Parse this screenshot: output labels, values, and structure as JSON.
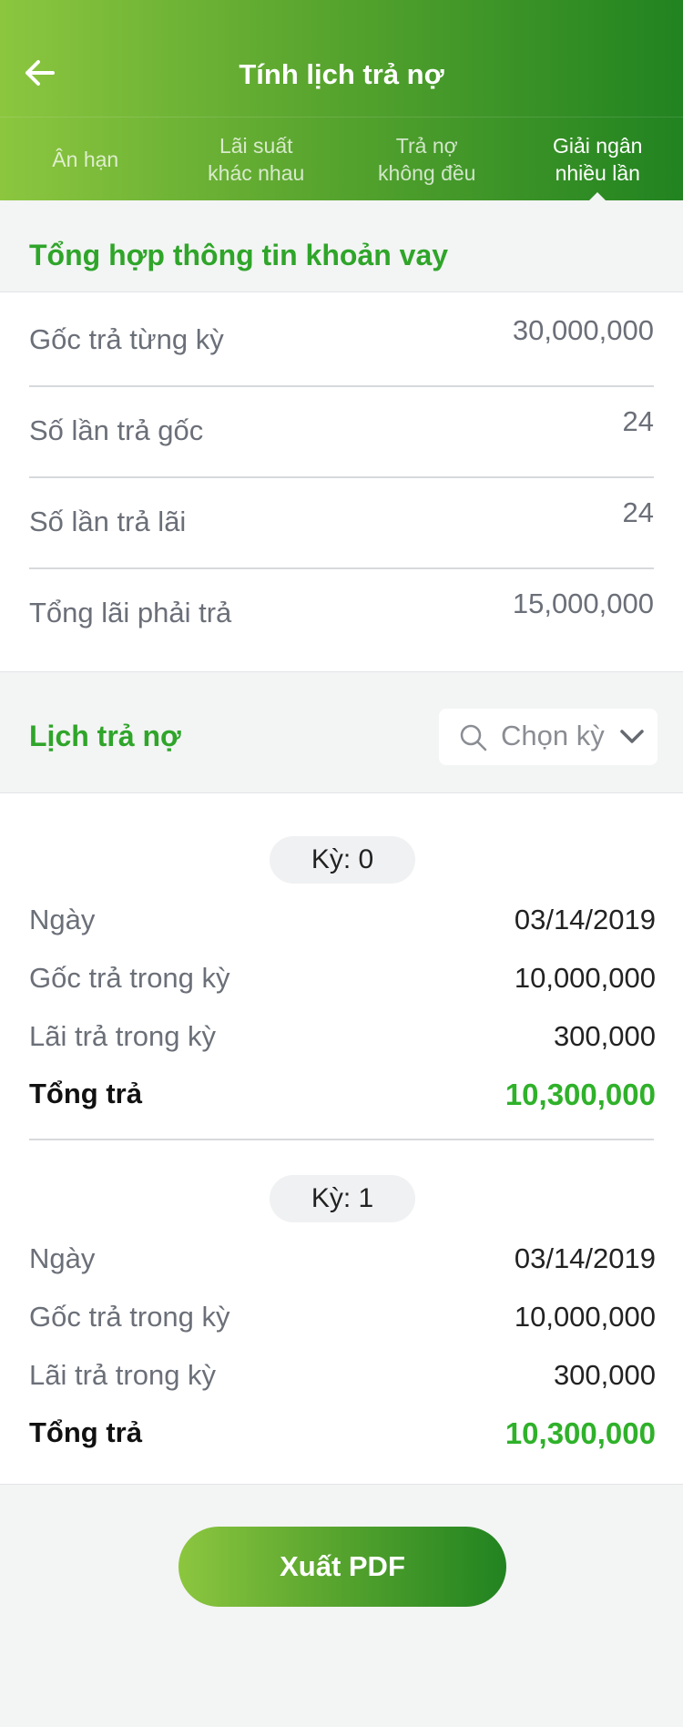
{
  "header": {
    "title": "Tính lịch trả nợ",
    "back_icon": "arrow-left-icon"
  },
  "tabs": [
    {
      "label": "Ân hạn",
      "active": false
    },
    {
      "label": "Lãi suất\nkhác nhau",
      "active": false
    },
    {
      "label": "Trả nợ\nkhông đều",
      "active": false
    },
    {
      "label": "Giải ngân\nnhiều lần",
      "active": true
    }
  ],
  "summary": {
    "title": "Tổng hợp thông tin khoản vay",
    "rows": [
      {
        "label": "Gốc trả từng kỳ",
        "value": "30,000,000"
      },
      {
        "label": "Số lần trả gốc",
        "value": "24"
      },
      {
        "label": "Số lần trả lãi",
        "value": "24"
      },
      {
        "label": "Tổng lãi phải trả",
        "value": "15,000,000"
      }
    ]
  },
  "schedule": {
    "title": "Lịch trả nợ",
    "select_placeholder": "Chọn kỳ",
    "periods": [
      {
        "badge": "Kỳ: 0",
        "rows": [
          {
            "label": "Ngày",
            "value": "03/14/2019"
          },
          {
            "label": "Gốc trả trong kỳ",
            "value": "10,000,000"
          },
          {
            "label": "Lãi trả trong kỳ",
            "value": "300,000"
          },
          {
            "label": "Tổng trả",
            "value": "10,300,000"
          }
        ]
      },
      {
        "badge": "Kỳ: 1",
        "rows": [
          {
            "label": "Ngày",
            "value": "03/14/2019"
          },
          {
            "label": "Gốc trả trong kỳ",
            "value": "10,000,000"
          },
          {
            "label": "Lãi trả trong kỳ",
            "value": "300,000"
          },
          {
            "label": "Tổng trả",
            "value": "10,300,000"
          }
        ]
      }
    ]
  },
  "export_button": "Xuất PDF",
  "colors": {
    "brand_green": "#2fa52a",
    "gradient_start": "#8cc63f",
    "gradient_end": "#218320"
  }
}
